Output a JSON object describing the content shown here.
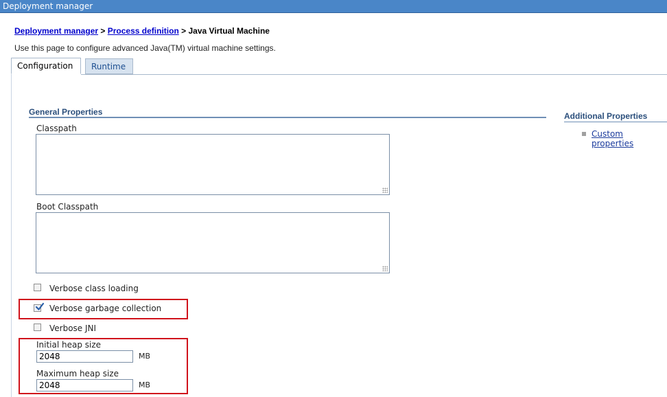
{
  "window": {
    "title": "Deployment manager"
  },
  "breadcrumb": {
    "items": [
      "Deployment manager",
      "Process definition"
    ],
    "separator": ">",
    "current": "Java Virtual Machine"
  },
  "page": {
    "description": "Use this page to configure advanced Java(TM) virtual machine settings."
  },
  "tabs": [
    {
      "label": "Configuration",
      "active": true
    },
    {
      "label": "Runtime",
      "active": false
    }
  ],
  "general": {
    "title": "General Properties",
    "classpath": {
      "label": "Classpath",
      "value": ""
    },
    "boot_classpath": {
      "label": "Boot Classpath",
      "value": ""
    },
    "verbose_class_loading": {
      "label": "Verbose class loading",
      "checked": false
    },
    "verbose_gc": {
      "label": "Verbose garbage collection",
      "checked": true
    },
    "verbose_jni": {
      "label": "Verbose JNI",
      "checked": false
    },
    "initial_heap": {
      "label": "Initial heap size",
      "value": "2048",
      "unit": "MB"
    },
    "max_heap": {
      "label": "Maximum heap size",
      "value": "2048",
      "unit": "MB"
    }
  },
  "additional": {
    "title": "Additional Properties",
    "links": [
      "Custom properties"
    ]
  },
  "colors": {
    "titlebar": "#4a86c8",
    "link": "#0000cc",
    "highlight": "#d0121b",
    "section": "#2b4f7c"
  }
}
